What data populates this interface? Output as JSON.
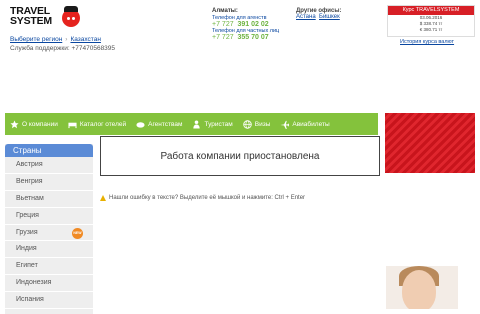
{
  "logo": {
    "line1": "TRAVEL",
    "line2": "SYSTEM"
  },
  "region": {
    "label": "Выберите регион",
    "value": "Казахстан"
  },
  "support": "Служба поддержки: +77470568395",
  "almaty": {
    "title": "Алматы:",
    "agencies_label": "Телефон для агенств",
    "agencies_prefix": "+7 727",
    "agencies_number": "391 02 02",
    "private_label": "Телефон для частных лиц",
    "private_prefix": "+7 727",
    "private_number": "355 70 07"
  },
  "other_offices": {
    "title": "Другие офисы:",
    "links": [
      "Астана",
      "Бишкек"
    ]
  },
  "rates": {
    "title": "Курс TRAVELSYSTEM",
    "date": "03.06.2016",
    "usd": "$ 338.74 тг",
    "eur": "€ 380.71 тг",
    "history_link": "История курса валют"
  },
  "nav": [
    {
      "label": "О компании",
      "icon": "star-icon"
    },
    {
      "label": "Каталог отелей",
      "icon": "bed-icon"
    },
    {
      "label": "Агентствам",
      "icon": "handshake-icon"
    },
    {
      "label": "Туристам",
      "icon": "person-icon"
    },
    {
      "label": "Визы",
      "icon": "globe-icon"
    },
    {
      "label": "Авиабилеты",
      "icon": "plane-icon"
    }
  ],
  "sidebar": {
    "title": "Страны",
    "countries": [
      "Австрия",
      "Венгрия",
      "Вьетнам",
      "Греция",
      "Грузия",
      "Индия",
      "Египет",
      "Индонезия",
      "Испания"
    ],
    "new_badge": "NEW"
  },
  "notice": "Работа компании приостановлена",
  "hint": "Нашли ошибку в тексте? Выделите её мышкой и нажмите: Ctrl + Enter",
  "colors": {
    "accent_green": "#84c23c",
    "brand_red": "#d71f26",
    "sidebar_blue": "#5b8bd6"
  }
}
